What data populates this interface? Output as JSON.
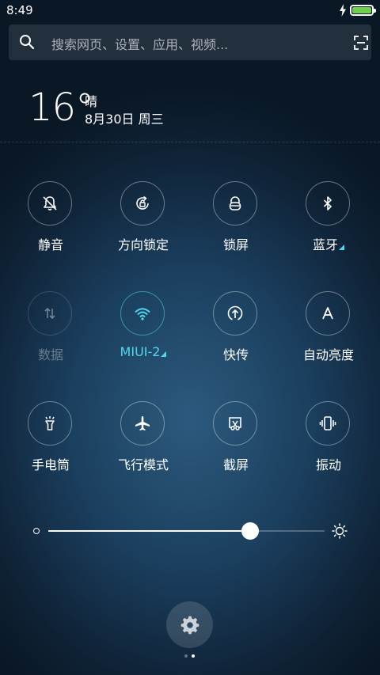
{
  "status_bar": {
    "time": "8:49",
    "battery_level": 1.0,
    "charging": true
  },
  "search": {
    "placeholder": "搜索网页、设置、应用、视频..."
  },
  "weather": {
    "temperature": "16°",
    "condition": "晴",
    "date": "8月30日 周三"
  },
  "toggles": [
    {
      "label": "静音",
      "icon": "silent-bell-icon",
      "state": "off"
    },
    {
      "label": "方向锁定",
      "icon": "rotation-lock-icon",
      "state": "off"
    },
    {
      "label": "锁屏",
      "icon": "lock-icon",
      "state": "off"
    },
    {
      "label": "蓝牙",
      "icon": "bluetooth-icon",
      "state": "off"
    },
    {
      "label": "数据",
      "icon": "mobile-data-icon",
      "state": "disabled"
    },
    {
      "label": "MIUI-2",
      "icon": "wifi-icon",
      "state": "on"
    },
    {
      "label": "快传",
      "icon": "quick-transfer-icon",
      "state": "off"
    },
    {
      "label": "自动亮度",
      "icon": "auto-brightness-icon",
      "state": "off"
    },
    {
      "label": "手电筒",
      "icon": "flashlight-icon",
      "state": "off"
    },
    {
      "label": "飞行模式",
      "icon": "airplane-icon",
      "state": "off"
    },
    {
      "label": "截屏",
      "icon": "screenshot-icon",
      "state": "off"
    },
    {
      "label": "振动",
      "icon": "vibrate-icon",
      "state": "off"
    }
  ],
  "brightness": {
    "level": 0.73
  },
  "pager": {
    "pages": 2,
    "current": 2
  },
  "colors": {
    "accent": "#4fd8ec",
    "battery": "#6cd14a"
  }
}
